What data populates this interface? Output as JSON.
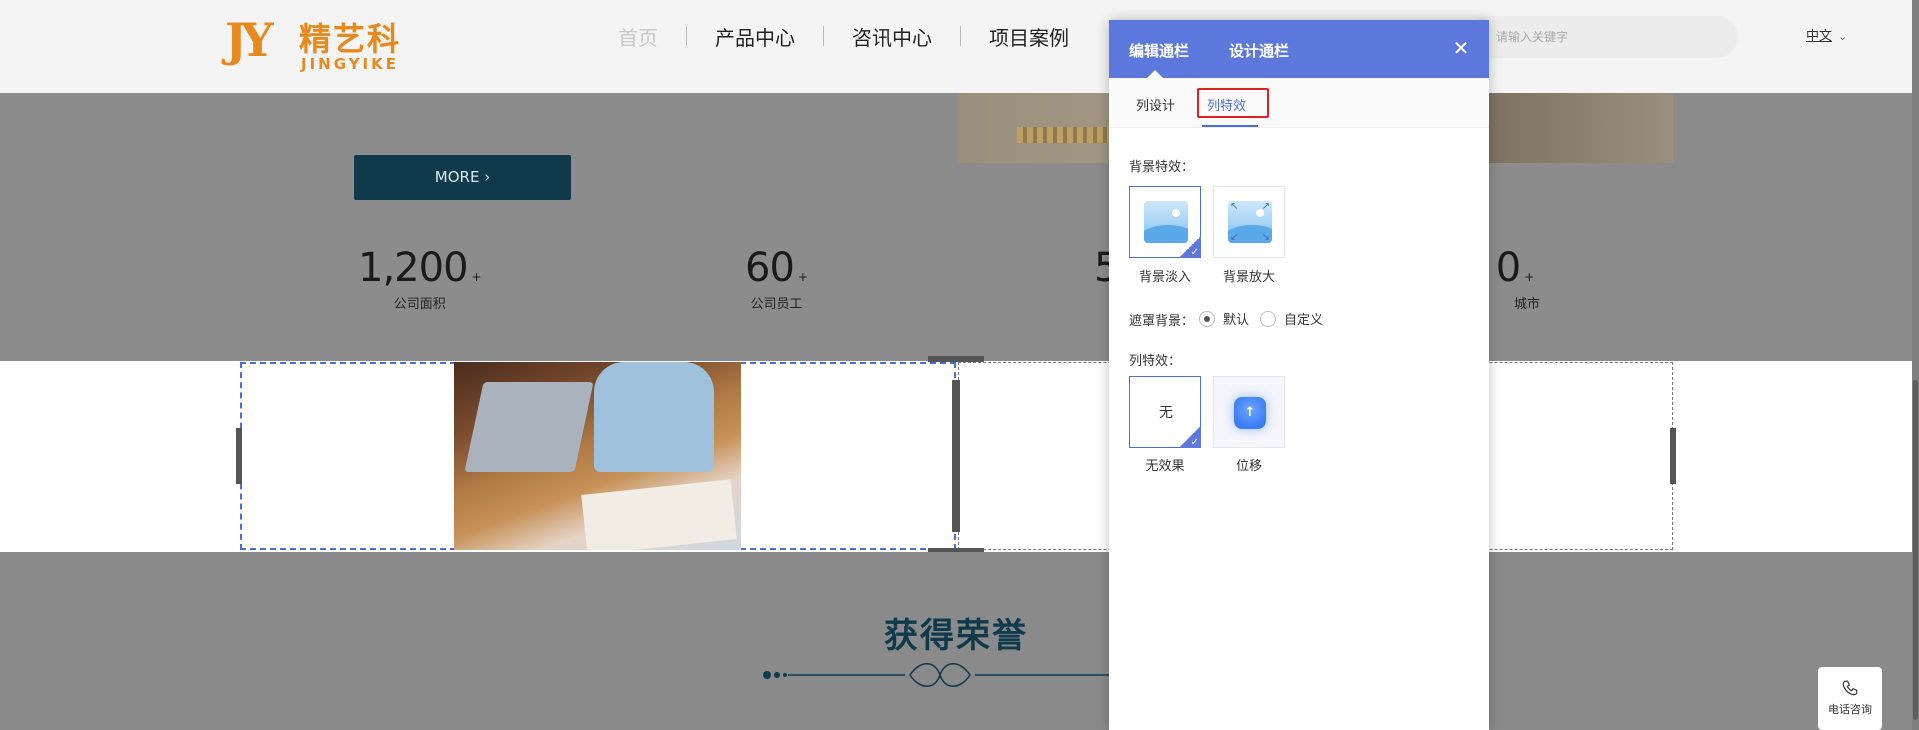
{
  "site": {
    "logo": {
      "mark": "JY",
      "name_cn": "精艺科",
      "name_en": "JINGYIKE"
    },
    "nav": [
      "首页",
      "产品中心",
      "咨讯中心",
      "项目案例"
    ],
    "search_placeholder": "请输入关键字",
    "language": "中文",
    "more_button": "MORE",
    "stats": [
      {
        "value": "1,200",
        "suffix": "+",
        "label": "公司面积"
      },
      {
        "value": "60",
        "suffix": "+",
        "label": "公司员工"
      },
      {
        "value": "5",
        "suffix": "",
        "label": ""
      },
      {
        "value": "0",
        "suffix": "+",
        "label": "城市"
      }
    ],
    "honor_title": "获得荣誉",
    "phone_consult": "电话咨询"
  },
  "panel": {
    "tabs": [
      "编辑通栏",
      "设计通栏"
    ],
    "subtabs": [
      "列设计",
      "列特效"
    ],
    "active_subtab": "列特效",
    "bg_effect_label": "背景特效：",
    "bg_effects": [
      {
        "name": "背景淡入",
        "selected": true
      },
      {
        "name": "背景放大",
        "selected": false
      }
    ],
    "mask_label": "遮罩背景：",
    "mask_options": [
      {
        "name": "默认",
        "selected": true
      },
      {
        "name": "自定义",
        "selected": false
      }
    ],
    "col_effect_label": "列特效：",
    "col_effects": [
      {
        "name": "无效果",
        "glyph": "无",
        "selected": true
      },
      {
        "name": "位移",
        "glyph": "↑",
        "selected": false
      }
    ],
    "accent_color": "#5d78dd",
    "highlight_color": "#e02020"
  }
}
